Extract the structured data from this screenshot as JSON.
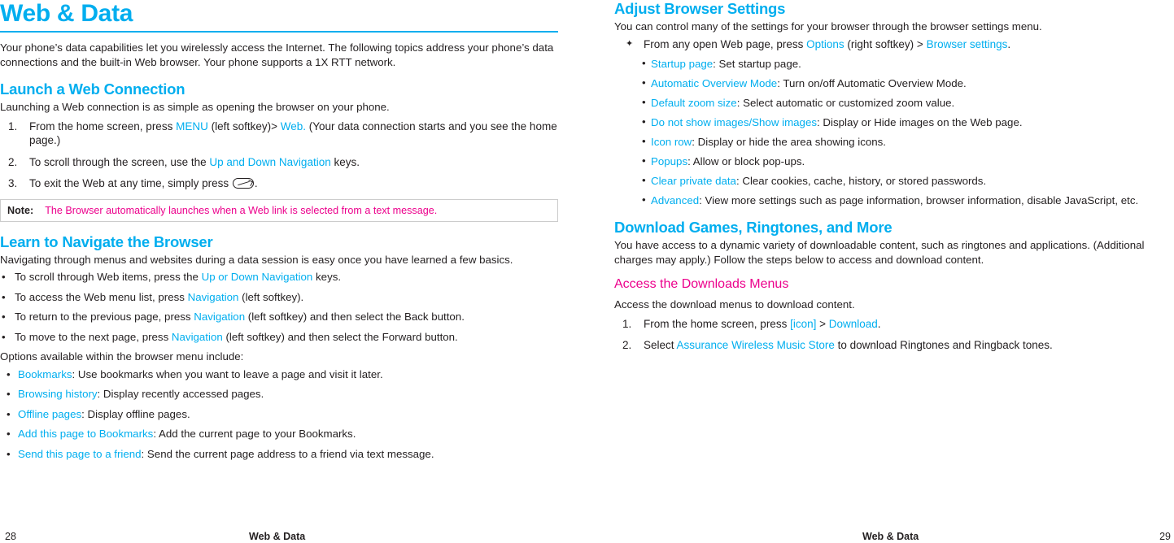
{
  "left": {
    "title": "Web & Data",
    "intro": "Your phone’s data capabilities let you wirelessly access the Internet. The following topics address your phone’s data connections and the built-in Web browser. Your phone supports a 1X RTT network.",
    "section1": {
      "heading": "Launch a Web Connection",
      "intro": "Launching a Web connection is as simple as opening the browser on your phone.",
      "steps": [
        {
          "num": "1.",
          "pre": "From the home screen, press ",
          "link1": "MENU",
          "mid": " (left softkey)> ",
          "link2": "Web.",
          "post": " (Your data connection starts and you see the home page.)"
        },
        {
          "num": "2.",
          "pre": "To scroll through the screen, use the ",
          "link1": "Up and Down Navigation",
          "mid": "",
          "link2": "",
          "post": " keys."
        },
        {
          "num": "3.",
          "pre": "To exit the Web at any time, simply press ",
          "link1": "",
          "mid": "",
          "link2": "",
          "post": "."
        }
      ],
      "note_label": "Note:",
      "note_text": "The Browser automatically launches when a Web link is selected from a text message."
    },
    "section2": {
      "heading": "Learn to Navigate the Browser",
      "intro": "Navigating through menus and websites during a data session is easy once you have learned a few basics.",
      "bullets": [
        {
          "pre": "To scroll through Web items, press the ",
          "link": "Up or Down Navigation",
          "post": " keys."
        },
        {
          "pre": "To access the Web menu list, press ",
          "link": "Navigation",
          "post": " (left softkey)."
        },
        {
          "pre": "To return to the previous page, press ",
          "link": "Navigation",
          "post": " (left softkey) and then select the Back button."
        },
        {
          "pre": "To move to the next page, press ",
          "link": "Navigation",
          "post": " (left softkey) and then select the Forward button."
        }
      ],
      "options_intro": "Options available within the browser menu include:",
      "options": [
        {
          "link": "Bookmarks",
          "post": ": Use bookmarks when you want to leave a page and visit it later."
        },
        {
          "link": "Browsing history",
          "post": ": Display recently accessed pages."
        },
        {
          "link": "Offline pages",
          "post": ": Display offline pages."
        },
        {
          "link": "Add this page to Bookmarks",
          "post": ": Add the current page to your Bookmarks."
        },
        {
          "link": "Send this page to a friend",
          "post": ": Send the current page address to a friend via text message."
        }
      ]
    },
    "footer_page": "28",
    "footer_title": "Web & Data"
  },
  "right": {
    "section1": {
      "heading": "Adjust Browser Settings",
      "intro": "You can control many of the settings for your browser through the browser settings menu.",
      "diamond": {
        "pre": "From any open Web page, press ",
        "link1": "Options",
        "mid": " (right softkey) > ",
        "link2": "Browser settings",
        "post": "."
      },
      "sub": [
        {
          "link": "Startup page",
          "post": ": Set startup page."
        },
        {
          "link": "Automatic Overview Mode",
          "post": ": Turn on/off Automatic Overview Mode."
        },
        {
          "link": "Default zoom size",
          "post": ": Select automatic or customized zoom value."
        },
        {
          "link": "Do not show images/Show images",
          "post": ": Display or Hide images on the Web page."
        },
        {
          "link": "Icon row",
          "post": ": Display or hide the area showing icons."
        },
        {
          "link": "Popups",
          "post": ": Allow or block pop-ups."
        },
        {
          "link": "Clear private data",
          "post": ": Clear cookies, cache, history, or stored passwords."
        },
        {
          "link": "Advanced",
          "post": ": View more settings such as page information, browser information, disable JavaScript, etc."
        }
      ]
    },
    "section2": {
      "heading": "Download Games, Ringtones, and More",
      "intro": "You have access to a dynamic variety of downloadable content, such as ringtones and applications. (Additional charges may apply.) Follow the steps below to access and download content.",
      "subheading": "Access the Downloads Menus",
      "subintro": "Access the download menus to download content.",
      "steps": [
        {
          "num": "1.",
          "pre": "From the home screen, press ",
          "link1": "[icon]",
          "mid": " > ",
          "link2": "Download",
          "post": "."
        },
        {
          "num": "2.",
          "pre": "Select ",
          "link1": "Assurance Wireless Music Store",
          "mid": "",
          "link2": "",
          "post": " to download Ringtones and Ringback tones."
        }
      ]
    },
    "footer_page": "29",
    "footer_title": "Web & Data"
  },
  "colors": {
    "accent_blue": "#00aeef",
    "accent_magenta": "#ec008c",
    "body_text": "#231f20"
  }
}
